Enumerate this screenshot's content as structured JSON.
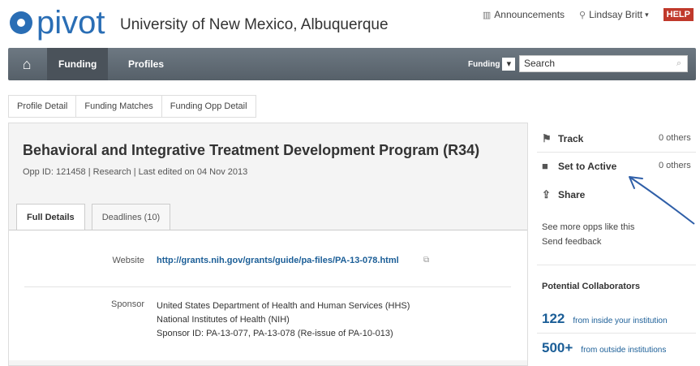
{
  "header": {
    "logo_text": "pivot",
    "institution": "University of New Mexico, Albuquerque",
    "announcements": "Announcements",
    "user": "Lindsay Britt",
    "user_caret": "▾",
    "help": "HELP"
  },
  "nav": {
    "home_icon": "home-icon",
    "tabs": [
      {
        "label": "Funding",
        "active": true
      },
      {
        "label": "Profiles",
        "active": false
      }
    ],
    "search_scope": "Funding",
    "search_placeholder": "Search"
  },
  "breadcrumb": [
    "Profile Detail",
    "Funding Matches",
    "Funding Opp Detail"
  ],
  "opportunity": {
    "title": "Behavioral and Integrative Treatment Development Program (R34)",
    "meta": "Opp ID: 121458  |  Research  |  Last edited on 04 Nov 2013",
    "tabs": [
      "Full Details",
      "Deadlines (10)"
    ],
    "website_label": "Website",
    "website_url": "http://grants.nih.gov/grants/guide/pa-files/PA-13-078.html",
    "sponsor_label": "Sponsor",
    "sponsor_lines": [
      "United States Department of Health and Human Services (HHS)",
      "National Institutes of Health (NIH)",
      "Sponsor ID: PA-13-077, PA-13-078     (Re-issue of PA-10-013)"
    ]
  },
  "sidebar": {
    "track": {
      "label": "Track",
      "count": "0 others"
    },
    "set_active": {
      "label": "Set to Active",
      "count": "0 others"
    },
    "share": {
      "label": "Share"
    },
    "links": [
      "See more opps like this",
      "Send feedback"
    ],
    "collab_title": "Potential Collaborators",
    "inside": {
      "num": "122",
      "text": "from inside your institution"
    },
    "outside": {
      "num": "500+",
      "text": "from outside institutions"
    }
  },
  "colors": {
    "brand": "#2a6eb5",
    "link": "#1b5e97",
    "nav": "#5f6972",
    "help": "#c0392b",
    "annotation": "#2f5fa8"
  }
}
